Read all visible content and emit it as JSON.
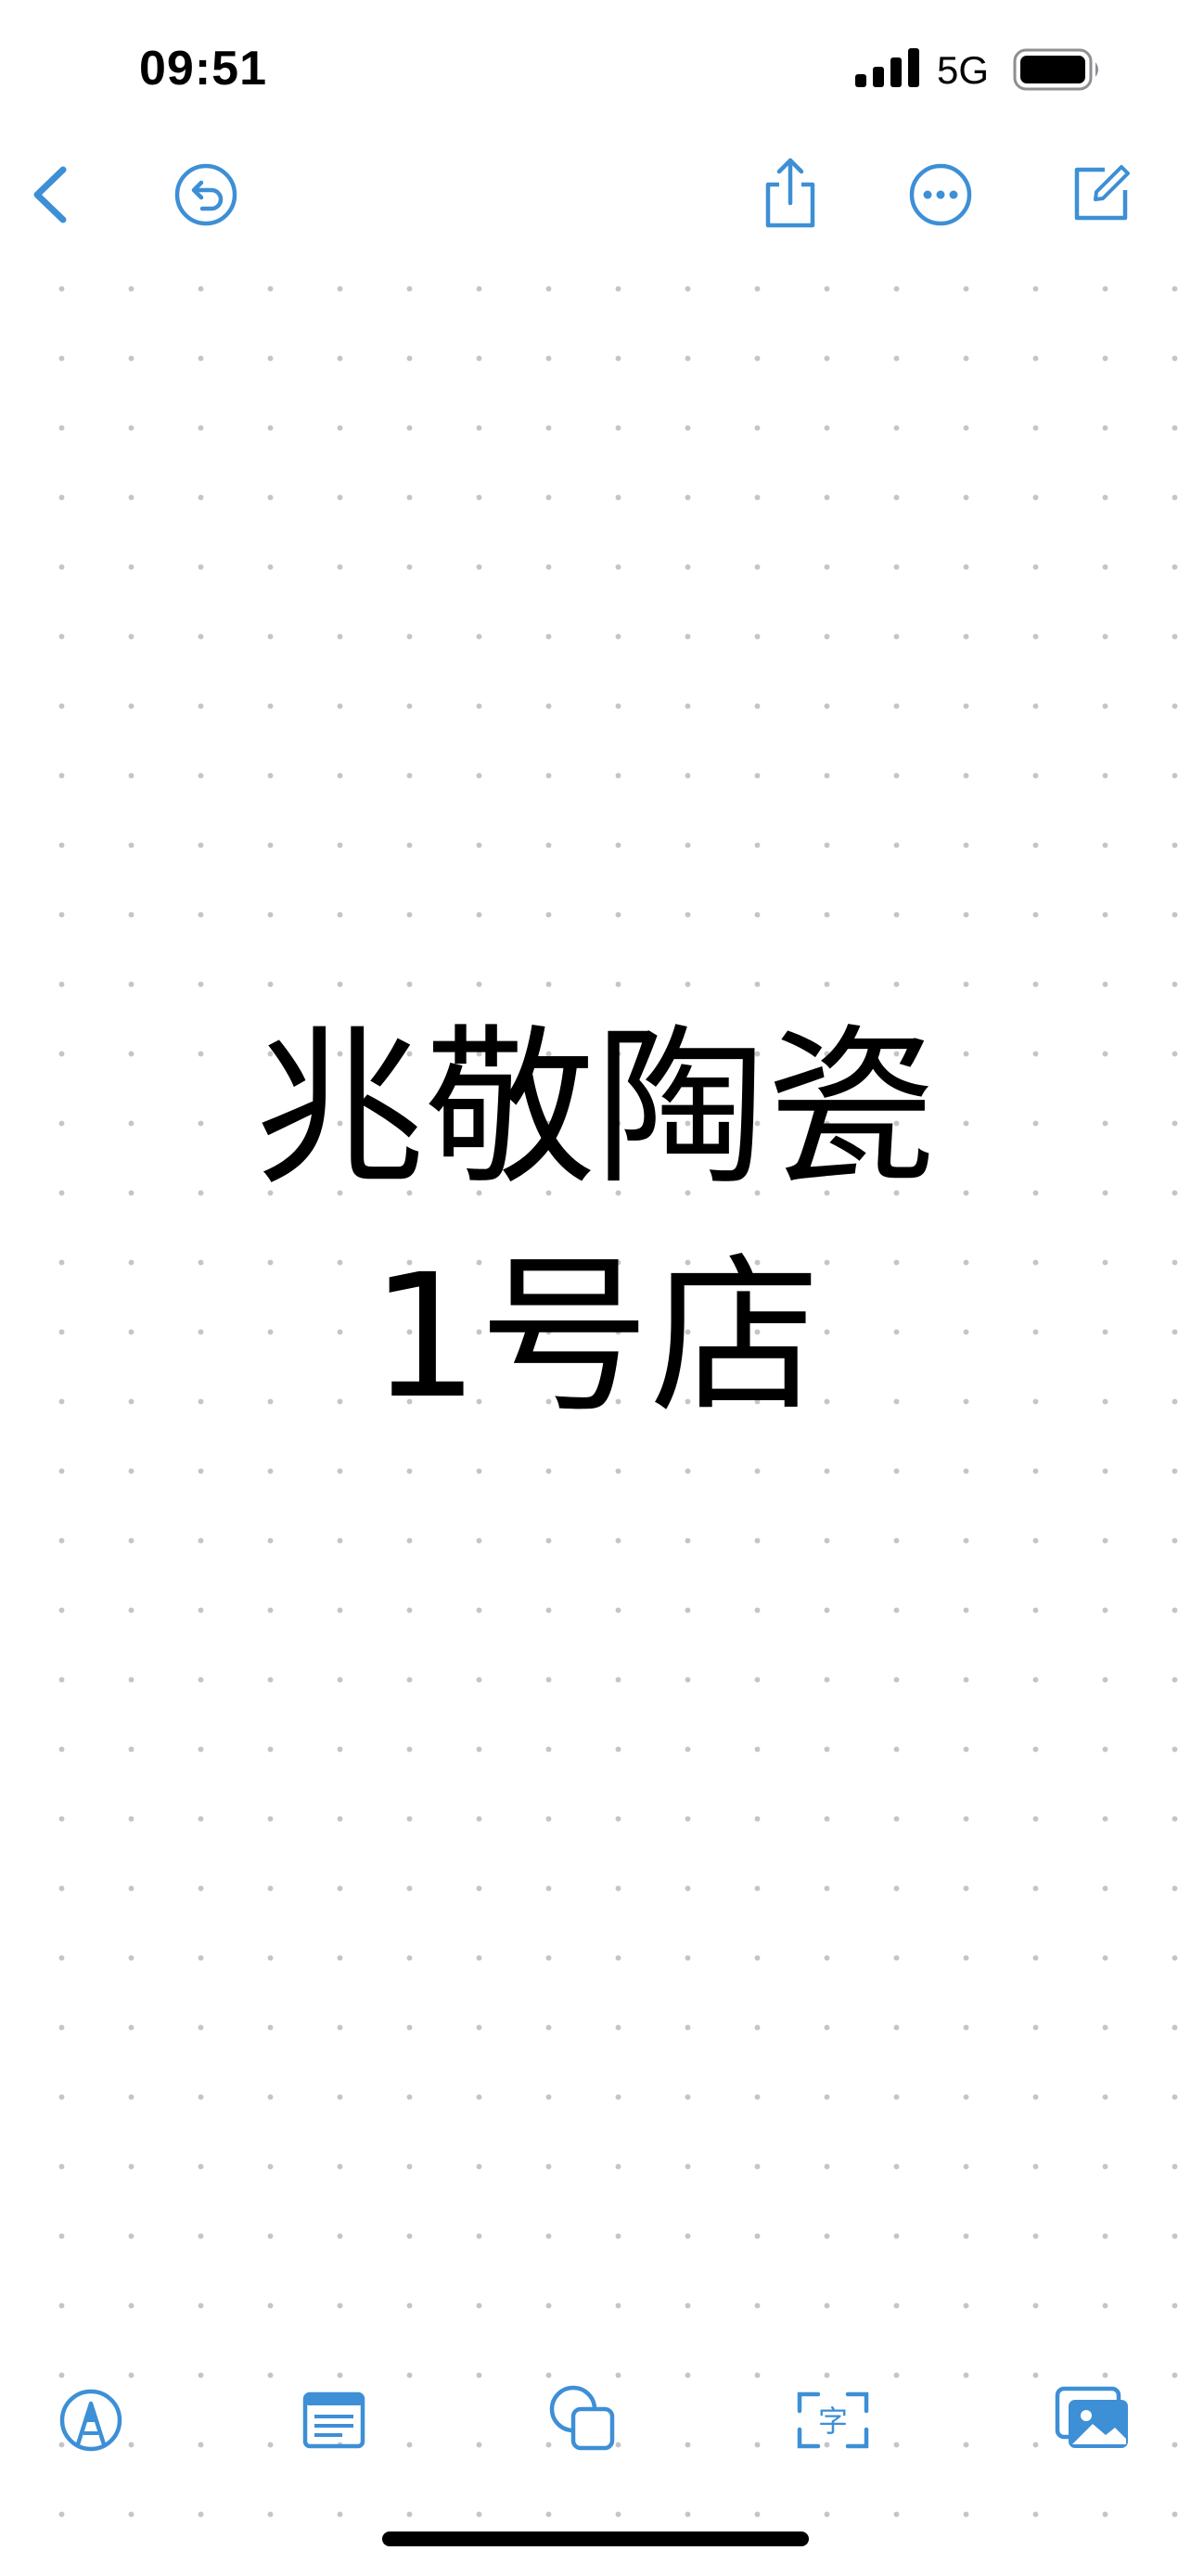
{
  "status_bar": {
    "time": "09:51",
    "network": "5G",
    "signal_icon": "cellular-signal-icon",
    "battery_icon": "battery-icon"
  },
  "toolbar": {
    "back_icon": "chevron-left-icon",
    "undo_icon": "undo-icon",
    "share_icon": "share-icon",
    "more_icon": "more-icon",
    "new_board_icon": "compose-icon"
  },
  "canvas": {
    "lines": [
      "兆敬陶瓷",
      "1号店"
    ]
  },
  "bottom_toolbar": {
    "pen_icon": "pen-tip-icon",
    "sticky_note_icon": "sticky-note-icon",
    "shapes_icon": "shapes-icon",
    "text_icon": "text-box-icon",
    "text_glyph": "字",
    "media_icon": "photo-icon"
  },
  "colors": {
    "accent": "#3d8fd6",
    "dot_grid": "#c4c4c9",
    "text": "#000000",
    "background": "#ffffff"
  }
}
